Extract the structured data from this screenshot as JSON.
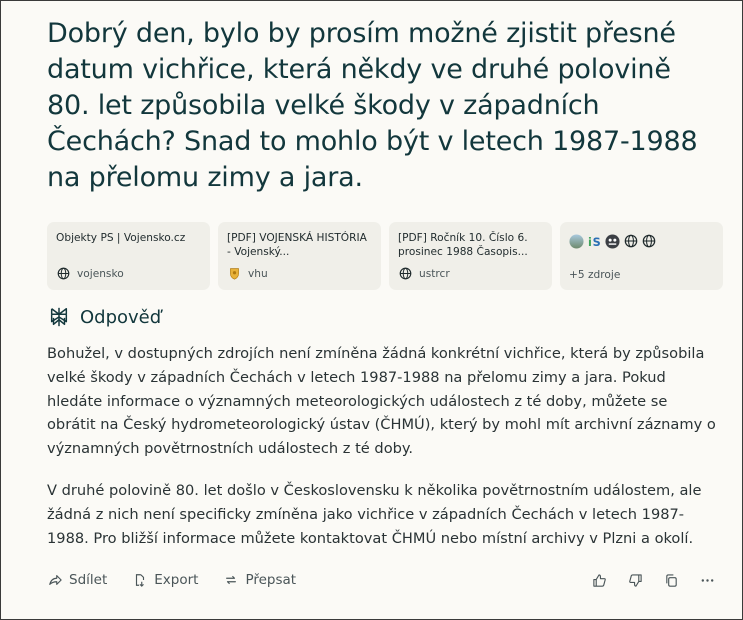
{
  "question": "Dobrý den, bylo by prosím možné zjistit přesné datum vichřice, která někdy ve druhé polovině 80. let způsobila velké škody v západních Čechách? Snad to mohlo být v letech 1987-1988 na přelomu zimy a jara.",
  "sources": [
    {
      "title": "Objekty PS | Vojensko.cz",
      "domain": "vojensko",
      "icon": "globe-icon"
    },
    {
      "title": "[PDF] VOJENSKÁ HISTÓRIA - Vojenský...",
      "domain": "vhu",
      "icon": "vhu-logo-icon"
    },
    {
      "title": "[PDF] Ročník 10. Číslo 6. prosinec 1988 Časopis...",
      "domain": "ustrcr",
      "icon": "globe-icon"
    }
  ],
  "more_sources": {
    "label": "+5 zdroje",
    "icons": [
      "landscape-favicon",
      "is-favicon",
      "chmu-favicon",
      "globe-icon",
      "globe-icon"
    ]
  },
  "answer": {
    "heading": "Odpověď",
    "paragraphs": [
      "Bohužel, v dostupných zdrojích není zmíněna žádná konkrétní vichřice, která by způsobila velké škody v západních Čechách v letech 1987-1988 na přelomu zimy a jara. Pokud hledáte informace o významných meteorologických událostech z té doby, můžete se obrátit na Český hydrometeorologický ústav (ČHMÚ), který by mohl mít archivní záznamy o významných povětrnostních událostech z té doby.",
      "V druhé polovině 80. let došlo v Československu k několika povětrnostním událostem, ale žádná z nich není specificky zmíněna jako vichřice v západních Čechách v letech 1987-1988. Pro bližší informace můžete kontaktovat ČHMÚ nebo místní archivy v Plzni a okolí."
    ]
  },
  "actions": {
    "share": "Sdílet",
    "export": "Export",
    "rewrite": "Přepsat"
  },
  "colors": {
    "background": "#fbfaf6",
    "card": "#f0efe9",
    "heading": "#12373c",
    "is_favicon_green": "#3fa45a",
    "is_favicon_blue": "#2a6fb5"
  }
}
